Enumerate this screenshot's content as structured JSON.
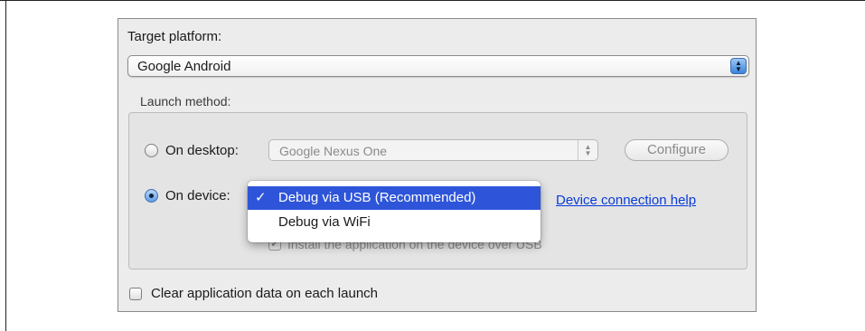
{
  "target_platform": {
    "label": "Target platform:",
    "selected": "Google Android",
    "icon": "popup-arrows-icon"
  },
  "launch_method": {
    "label": "Launch method:",
    "desktop": {
      "label": "On desktop:",
      "selected": "Google Nexus One",
      "configure_label": "Configure",
      "enabled": false
    },
    "device": {
      "label": "On device:",
      "selected": "Debug via USB (Recommended)",
      "options": [
        "Debug via USB (Recommended)",
        "Debug via WiFi"
      ],
      "help_link": "Device connection help",
      "install_label": "Install the application on the device over USB",
      "install_checked": true
    },
    "device_selected": true
  },
  "clear_data": {
    "label": "Clear application data on each launch",
    "checked": false
  },
  "colors": {
    "menu_highlight": "#2e55d9",
    "link": "#0a3bd7",
    "panel_bg": "#ececec"
  }
}
